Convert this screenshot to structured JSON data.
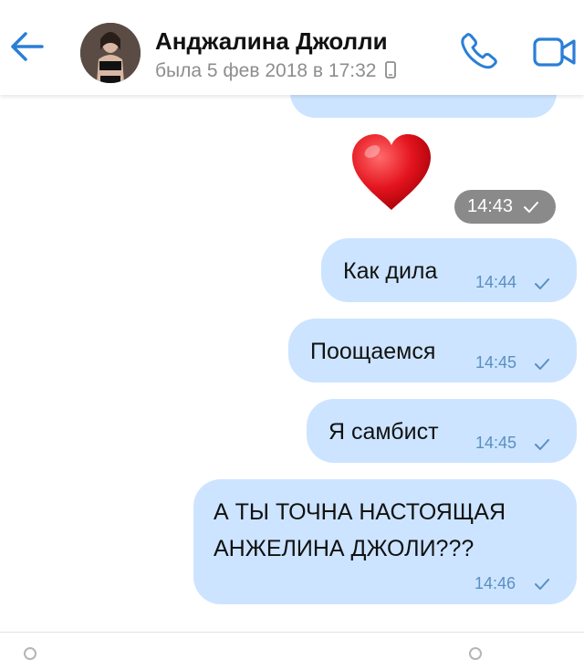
{
  "header": {
    "contact_name": "Анджалина Джолли",
    "last_seen": "была 5 фев 2018 в 17:32"
  },
  "messages": [
    {
      "type": "sticker",
      "sticker_icon": "red-heart",
      "time": "14:43",
      "status": "sent"
    },
    {
      "type": "text",
      "text": "Как дила",
      "time": "14:44",
      "status": "sent"
    },
    {
      "type": "text",
      "text": "Поощаемся",
      "time": "14:45",
      "status": "sent"
    },
    {
      "type": "text",
      "text": "Я самбист",
      "time": "14:45",
      "status": "sent"
    },
    {
      "type": "text",
      "lines": [
        "А ТЫ ТОЧНА НАСТОЯЩАЯ",
        "АНЖЕЛИНА ДЖОЛИ???"
      ],
      "time": "14:46",
      "status": "sent"
    }
  ],
  "colors": {
    "accent": "#2a7fd6",
    "outgoing_bubble": "#cce4ff",
    "time_text": "#5a8fc2"
  }
}
